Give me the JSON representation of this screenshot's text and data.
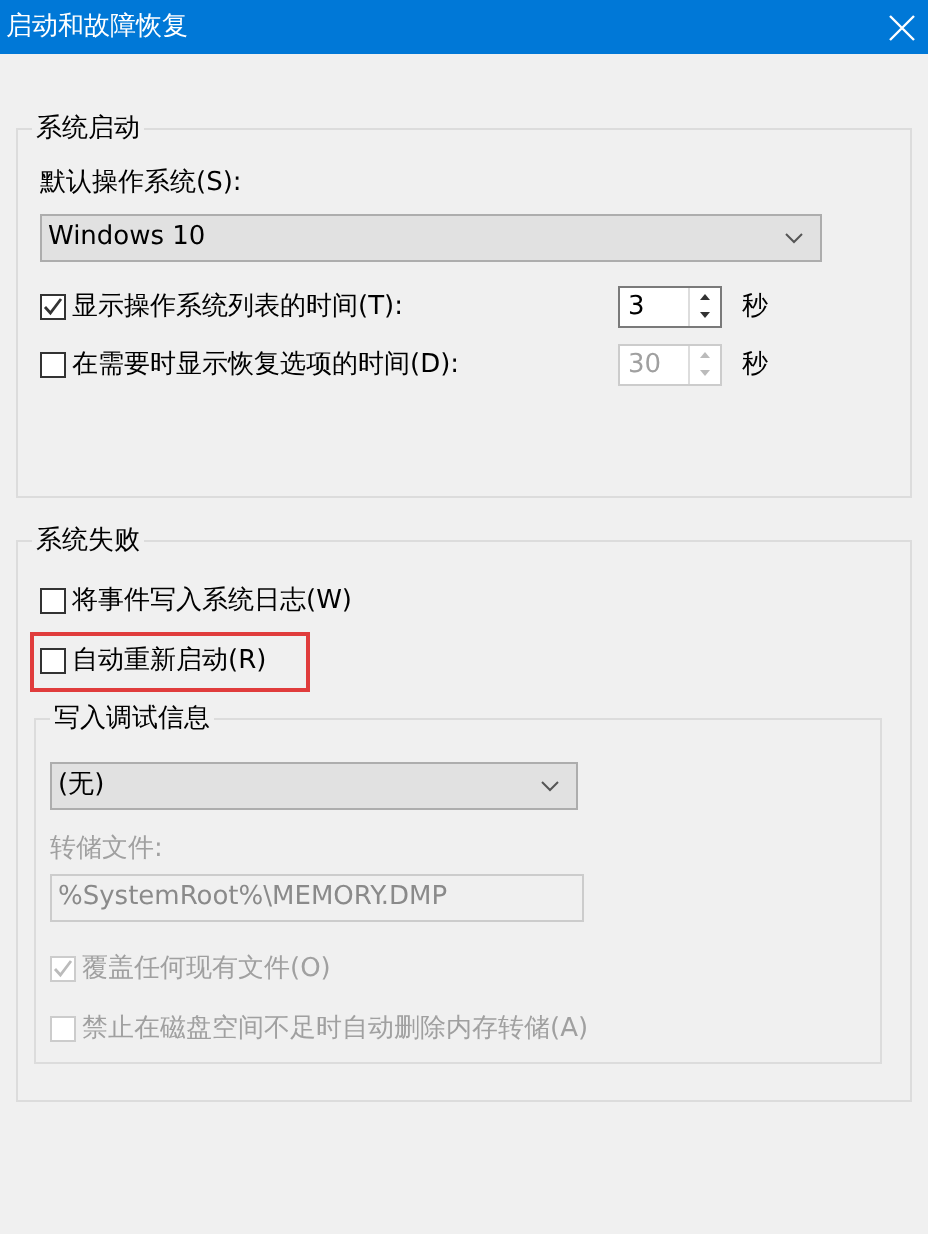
{
  "window": {
    "title": "启动和故障恢复"
  },
  "startup": {
    "title": "系统启动",
    "default_os_label": "默认操作系统(S):",
    "default_os": "Windows 10",
    "rows": [
      {
        "label": "显示操作系统列表的时间(T):",
        "checked": true,
        "value": "3",
        "disabled": false,
        "unit": "秒"
      },
      {
        "label": "在需要时显示恢复选项的时间(D):",
        "checked": false,
        "value": "30",
        "disabled": true,
        "unit": "秒"
      }
    ]
  },
  "failure": {
    "title": "系统失败",
    "options": [
      {
        "label": "将事件写入系统日志(W)",
        "checked": false,
        "highlighted": false
      },
      {
        "label": "自动重新启动(R)",
        "checked": false,
        "highlighted": true
      }
    ],
    "debug": {
      "title": "写入调试信息",
      "type": "(无)",
      "dump_file_label": "转储文件:",
      "dump_file": "%SystemRoot%\\MEMORY.DMP",
      "dump_file_disabled": true,
      "options": [
        {
          "label": "覆盖任何现有文件(O)",
          "checked": true,
          "disabled": true
        },
        {
          "label": "禁止在磁盘空间不足时自动删除内存转储(A)",
          "checked": false,
          "disabled": true
        }
      ]
    }
  }
}
